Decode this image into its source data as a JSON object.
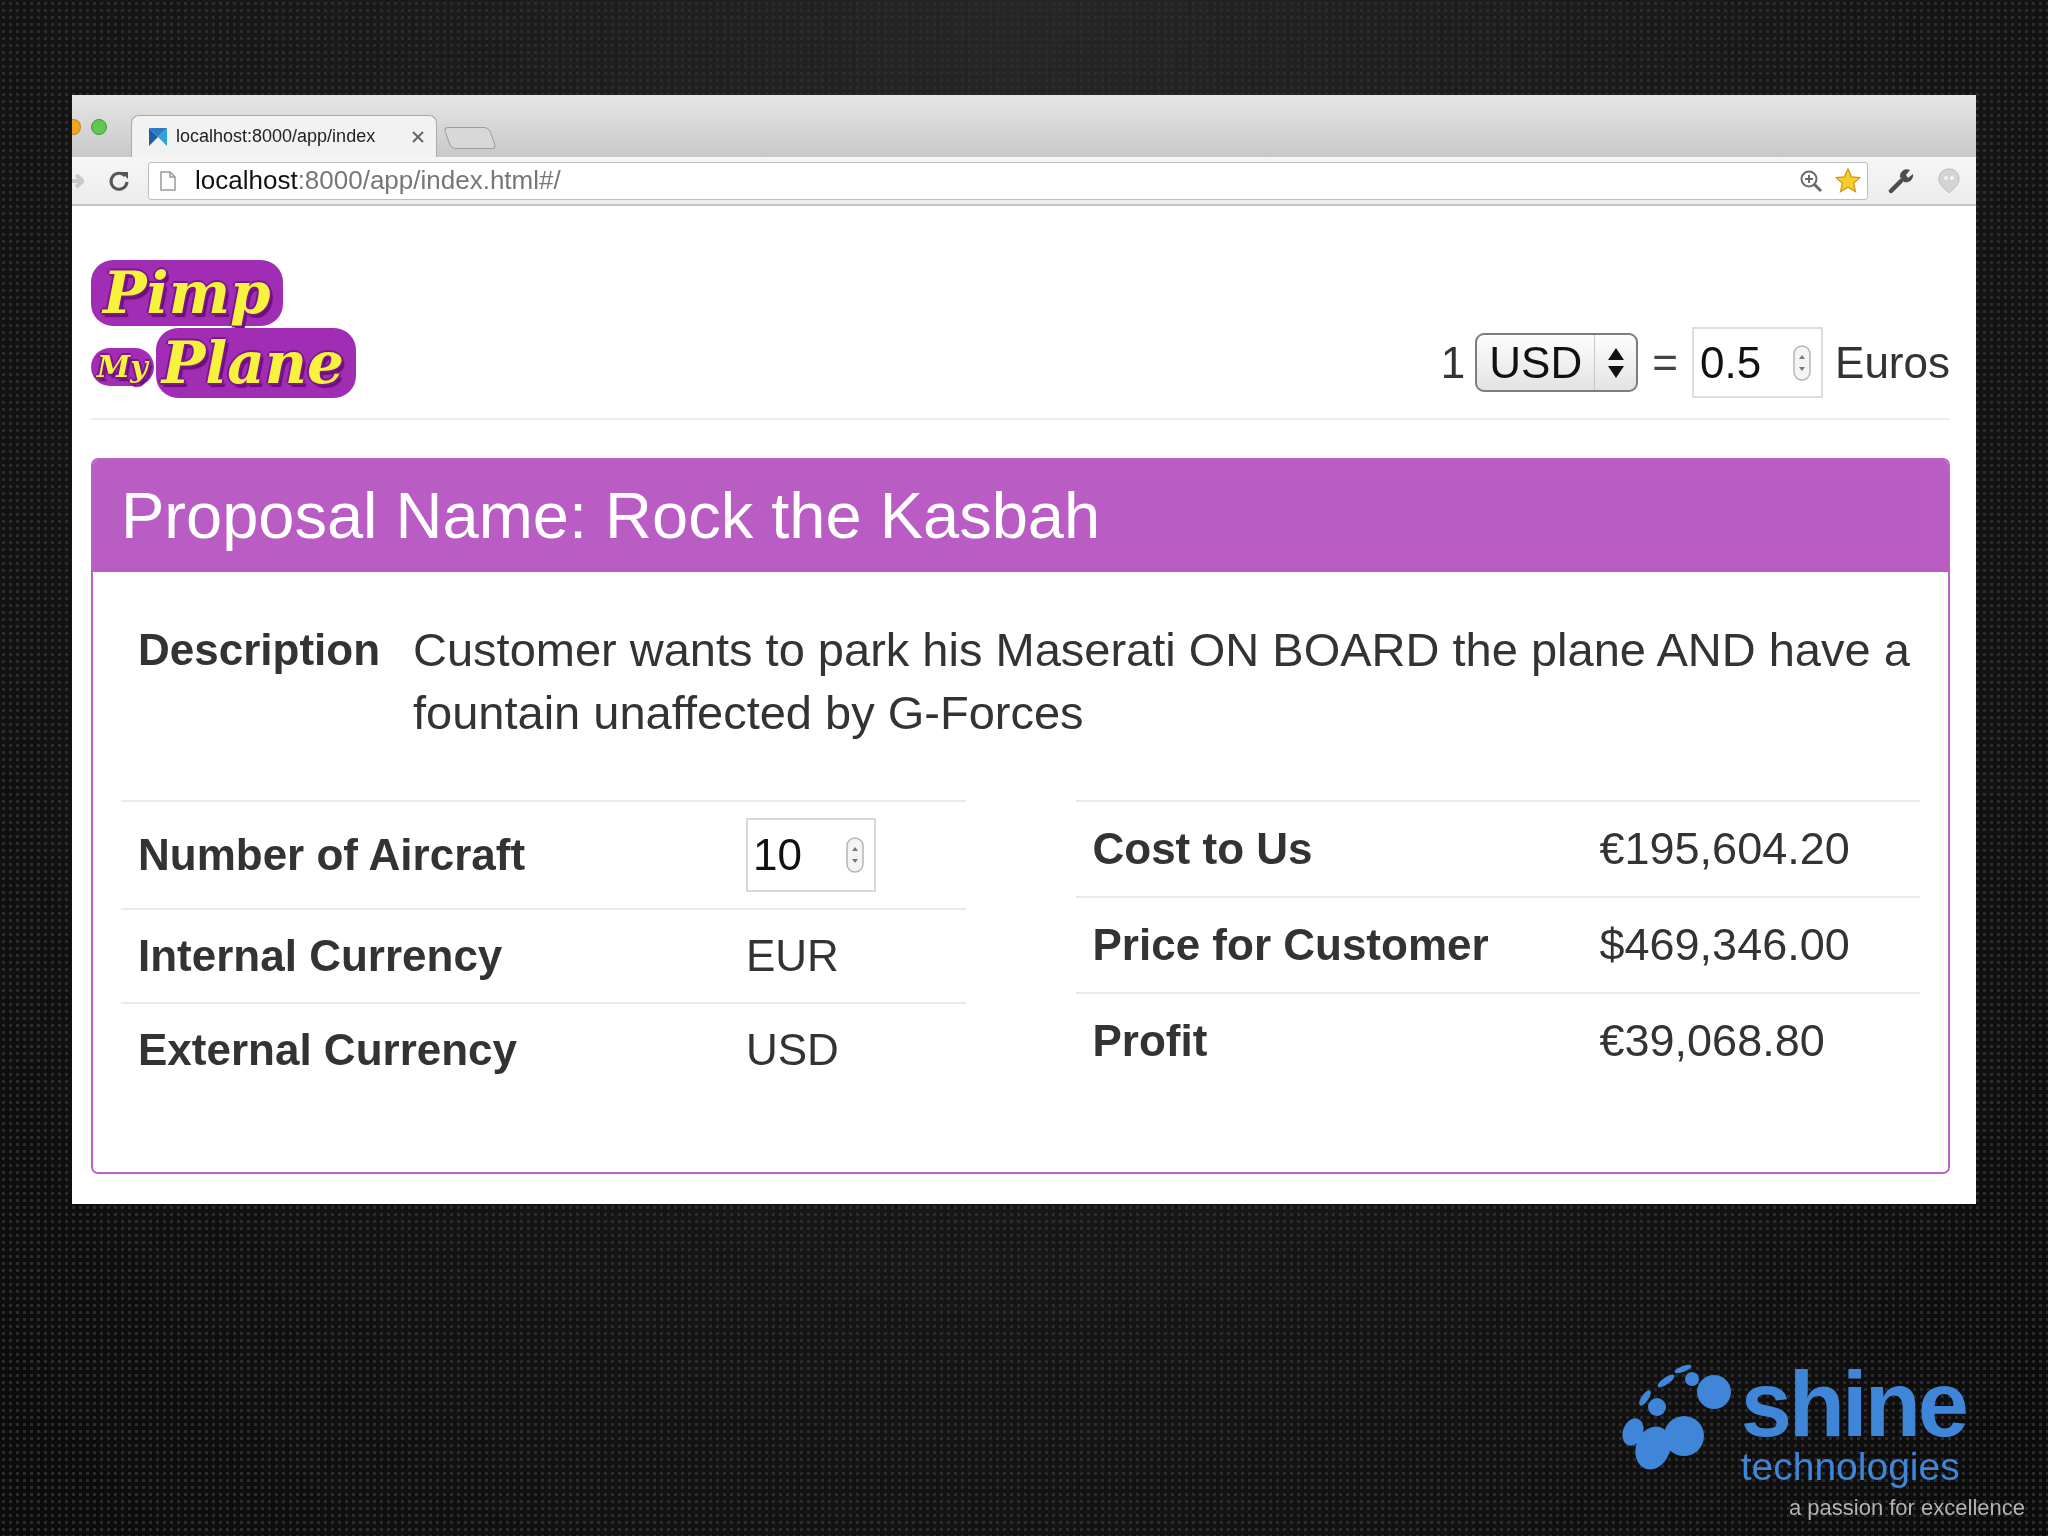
{
  "browser": {
    "tabs": [
      {
        "title": "localhost:8000/app/index",
        "selected": true
      }
    ],
    "forward_button": {
      "disabled": true
    },
    "address_bar": {
      "host": "localhost",
      "path": ":8000/app/index.html#/"
    }
  },
  "header": {
    "logo": [
      "Pimp",
      "My",
      "Plane"
    ],
    "converter": {
      "amount": "1",
      "currency": "USD",
      "equals": "=",
      "rate": "0.5",
      "target": "Euros"
    }
  },
  "proposal": {
    "title": "Proposal Name: Rock the Kasbah",
    "description_label": "Description",
    "description": "Customer wants to park his Maserati ON BOARD the plane AND have a fountain unaffected by G-Forces",
    "left_table": [
      {
        "label": "Number of Aircraft",
        "value": "10",
        "kind": "input"
      },
      {
        "label": "Internal Currency",
        "value": "EUR",
        "kind": "text"
      },
      {
        "label": "External Currency",
        "value": "USD",
        "kind": "text"
      }
    ],
    "right_table": [
      {
        "label": "Cost to Us",
        "value": "€195,604.20"
      },
      {
        "label": "Price for Customer",
        "value": "$469,346.00"
      },
      {
        "label": "Profit",
        "value": "€39,068.80"
      }
    ]
  },
  "branding": {
    "name": "shine",
    "subtitle": "technologies",
    "tagline": "a passion for excellence"
  }
}
